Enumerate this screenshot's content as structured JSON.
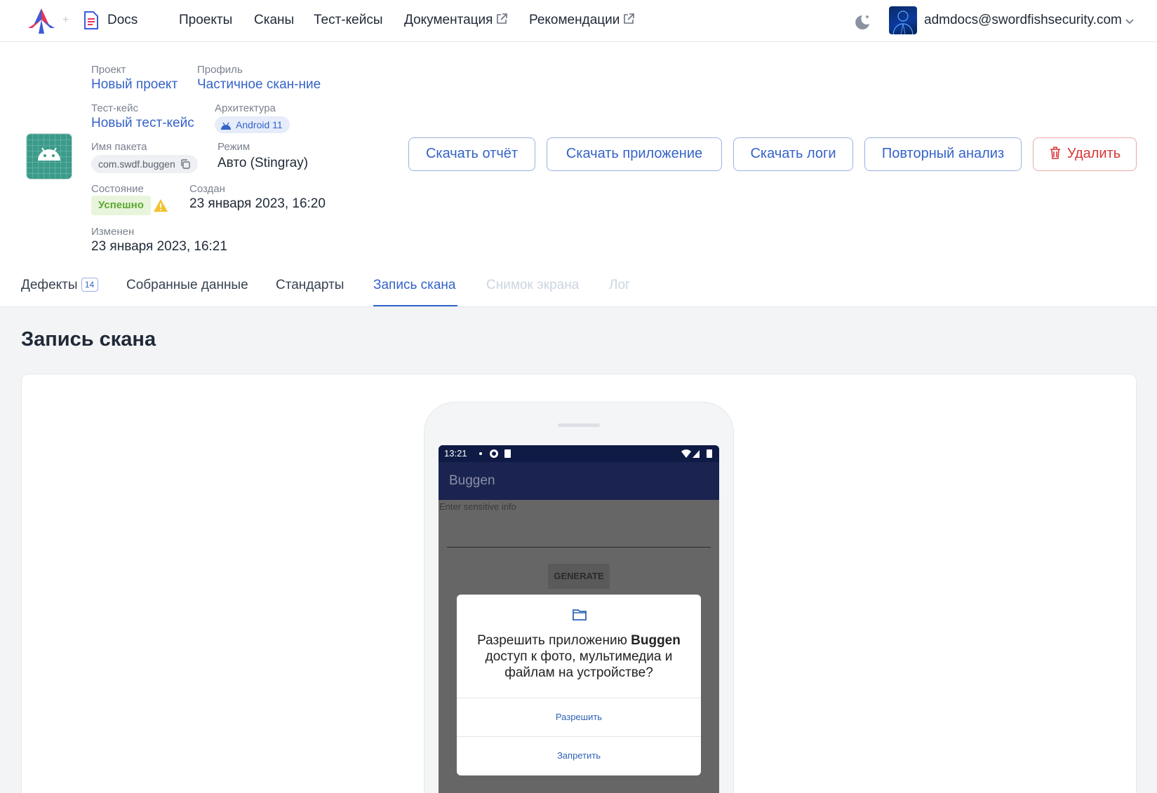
{
  "topbar": {
    "docs_label": "Docs",
    "nav": [
      {
        "label": "Проекты",
        "external": false
      },
      {
        "label": "Сканы",
        "external": false
      },
      {
        "label": "Тест-кейсы",
        "external": false
      },
      {
        "label": "Документация",
        "external": true
      },
      {
        "label": "Рекомендации",
        "external": true
      }
    ],
    "user_email": "admdocs@swordfishsecurity.com"
  },
  "scan": {
    "project_label": "Проект",
    "project_value": "Новый проект",
    "profile_label": "Профиль",
    "profile_value": "Частичное скан-ние",
    "testcase_label": "Тест-кейс",
    "testcase_value": "Новый тест-кейс",
    "arch_label": "Архитектура",
    "arch_value": "Android 11",
    "package_label": "Имя пакета",
    "package_value": "com.swdf.buggen",
    "mode_label": "Режим",
    "mode_value": "Авто (Stingray)",
    "status_label": "Состояние",
    "status_value": "Успешно",
    "created_label": "Создан",
    "created_value": "23 января 2023, 16:20",
    "modified_label": "Изменен",
    "modified_value": "23 января 2023, 16:21"
  },
  "actions": {
    "download_report": "Скачать отчёт",
    "download_app": "Скачать приложение",
    "download_logs": "Скачать логи",
    "reanalyze": "Повторный анализ",
    "delete": "Удалить"
  },
  "tabs": [
    {
      "label": "Дефекты",
      "badge": "14",
      "state": "normal"
    },
    {
      "label": "Собранные данные",
      "badge": null,
      "state": "normal"
    },
    {
      "label": "Стандарты",
      "badge": null,
      "state": "normal"
    },
    {
      "label": "Запись скана",
      "badge": null,
      "state": "active"
    },
    {
      "label": "Снимок экрана",
      "badge": null,
      "state": "disabled"
    },
    {
      "label": "Лог",
      "badge": null,
      "state": "disabled"
    }
  ],
  "main": {
    "title": "Запись скана"
  },
  "device": {
    "time": "13:21",
    "app_title": "Buggen",
    "input_hint": "Enter sensitive info",
    "generate_label": "GENERATE",
    "dialog": {
      "text_before": "Разрешить приложению ",
      "app_name": "Buggen",
      "text_after": " доступ к фото, мультимедиа и файлам на устройстве?",
      "allow": "Разрешить",
      "deny": "Запретить"
    }
  },
  "colors": {
    "accent": "#3563c9",
    "danger": "#d93636",
    "success_bg": "#e8f5dc",
    "success_text": "#5aa832",
    "android_appbar": "#1b2450"
  }
}
